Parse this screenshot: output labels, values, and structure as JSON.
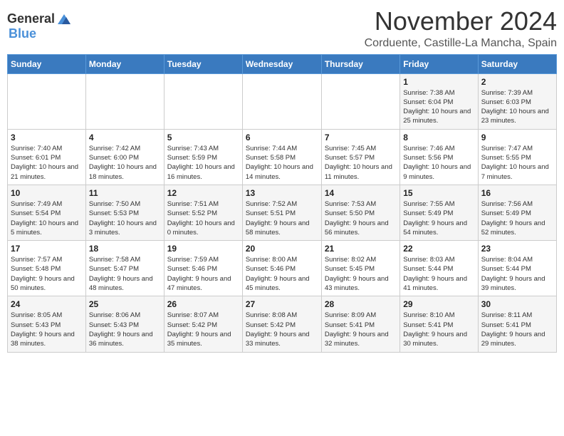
{
  "header": {
    "logo_general": "General",
    "logo_blue": "Blue",
    "month": "November 2024",
    "location": "Corduente, Castille-La Mancha, Spain"
  },
  "calendar": {
    "days_of_week": [
      "Sunday",
      "Monday",
      "Tuesday",
      "Wednesday",
      "Thursday",
      "Friday",
      "Saturday"
    ],
    "weeks": [
      [
        {
          "day": "",
          "info": ""
        },
        {
          "day": "",
          "info": ""
        },
        {
          "day": "",
          "info": ""
        },
        {
          "day": "",
          "info": ""
        },
        {
          "day": "",
          "info": ""
        },
        {
          "day": "1",
          "info": "Sunrise: 7:38 AM\nSunset: 6:04 PM\nDaylight: 10 hours and 25 minutes."
        },
        {
          "day": "2",
          "info": "Sunrise: 7:39 AM\nSunset: 6:03 PM\nDaylight: 10 hours and 23 minutes."
        }
      ],
      [
        {
          "day": "3",
          "info": "Sunrise: 7:40 AM\nSunset: 6:01 PM\nDaylight: 10 hours and 21 minutes."
        },
        {
          "day": "4",
          "info": "Sunrise: 7:42 AM\nSunset: 6:00 PM\nDaylight: 10 hours and 18 minutes."
        },
        {
          "day": "5",
          "info": "Sunrise: 7:43 AM\nSunset: 5:59 PM\nDaylight: 10 hours and 16 minutes."
        },
        {
          "day": "6",
          "info": "Sunrise: 7:44 AM\nSunset: 5:58 PM\nDaylight: 10 hours and 14 minutes."
        },
        {
          "day": "7",
          "info": "Sunrise: 7:45 AM\nSunset: 5:57 PM\nDaylight: 10 hours and 11 minutes."
        },
        {
          "day": "8",
          "info": "Sunrise: 7:46 AM\nSunset: 5:56 PM\nDaylight: 10 hours and 9 minutes."
        },
        {
          "day": "9",
          "info": "Sunrise: 7:47 AM\nSunset: 5:55 PM\nDaylight: 10 hours and 7 minutes."
        }
      ],
      [
        {
          "day": "10",
          "info": "Sunrise: 7:49 AM\nSunset: 5:54 PM\nDaylight: 10 hours and 5 minutes."
        },
        {
          "day": "11",
          "info": "Sunrise: 7:50 AM\nSunset: 5:53 PM\nDaylight: 10 hours and 3 minutes."
        },
        {
          "day": "12",
          "info": "Sunrise: 7:51 AM\nSunset: 5:52 PM\nDaylight: 10 hours and 0 minutes."
        },
        {
          "day": "13",
          "info": "Sunrise: 7:52 AM\nSunset: 5:51 PM\nDaylight: 9 hours and 58 minutes."
        },
        {
          "day": "14",
          "info": "Sunrise: 7:53 AM\nSunset: 5:50 PM\nDaylight: 9 hours and 56 minutes."
        },
        {
          "day": "15",
          "info": "Sunrise: 7:55 AM\nSunset: 5:49 PM\nDaylight: 9 hours and 54 minutes."
        },
        {
          "day": "16",
          "info": "Sunrise: 7:56 AM\nSunset: 5:49 PM\nDaylight: 9 hours and 52 minutes."
        }
      ],
      [
        {
          "day": "17",
          "info": "Sunrise: 7:57 AM\nSunset: 5:48 PM\nDaylight: 9 hours and 50 minutes."
        },
        {
          "day": "18",
          "info": "Sunrise: 7:58 AM\nSunset: 5:47 PM\nDaylight: 9 hours and 48 minutes."
        },
        {
          "day": "19",
          "info": "Sunrise: 7:59 AM\nSunset: 5:46 PM\nDaylight: 9 hours and 47 minutes."
        },
        {
          "day": "20",
          "info": "Sunrise: 8:00 AM\nSunset: 5:46 PM\nDaylight: 9 hours and 45 minutes."
        },
        {
          "day": "21",
          "info": "Sunrise: 8:02 AM\nSunset: 5:45 PM\nDaylight: 9 hours and 43 minutes."
        },
        {
          "day": "22",
          "info": "Sunrise: 8:03 AM\nSunset: 5:44 PM\nDaylight: 9 hours and 41 minutes."
        },
        {
          "day": "23",
          "info": "Sunrise: 8:04 AM\nSunset: 5:44 PM\nDaylight: 9 hours and 39 minutes."
        }
      ],
      [
        {
          "day": "24",
          "info": "Sunrise: 8:05 AM\nSunset: 5:43 PM\nDaylight: 9 hours and 38 minutes."
        },
        {
          "day": "25",
          "info": "Sunrise: 8:06 AM\nSunset: 5:43 PM\nDaylight: 9 hours and 36 minutes."
        },
        {
          "day": "26",
          "info": "Sunrise: 8:07 AM\nSunset: 5:42 PM\nDaylight: 9 hours and 35 minutes."
        },
        {
          "day": "27",
          "info": "Sunrise: 8:08 AM\nSunset: 5:42 PM\nDaylight: 9 hours and 33 minutes."
        },
        {
          "day": "28",
          "info": "Sunrise: 8:09 AM\nSunset: 5:41 PM\nDaylight: 9 hours and 32 minutes."
        },
        {
          "day": "29",
          "info": "Sunrise: 8:10 AM\nSunset: 5:41 PM\nDaylight: 9 hours and 30 minutes."
        },
        {
          "day": "30",
          "info": "Sunrise: 8:11 AM\nSunset: 5:41 PM\nDaylight: 9 hours and 29 minutes."
        }
      ]
    ]
  }
}
